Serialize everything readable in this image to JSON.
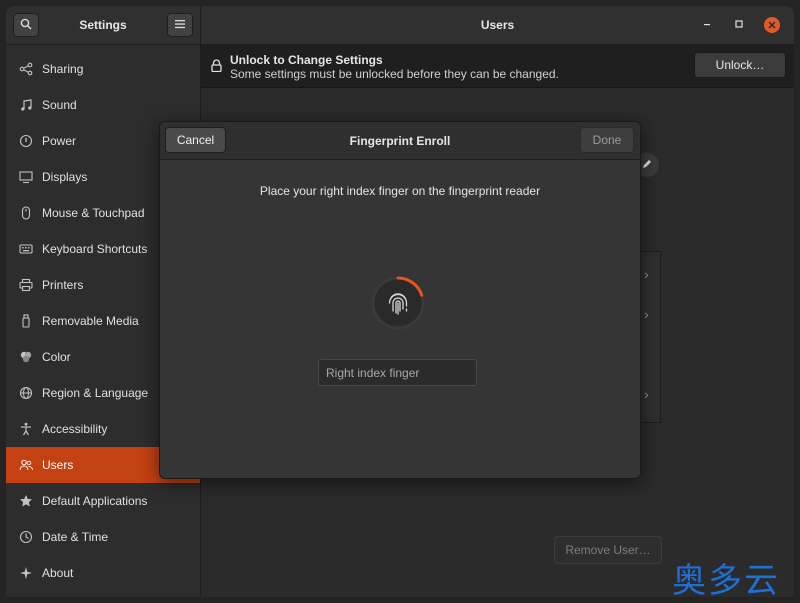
{
  "app": {
    "title": "Settings"
  },
  "window": {
    "title": "Users"
  },
  "sidebar": {
    "items": [
      {
        "label": "Sharing",
        "icon": "share-icon"
      },
      {
        "label": "Sound",
        "icon": "music-note-icon"
      },
      {
        "label": "Power",
        "icon": "power-icon"
      },
      {
        "label": "Displays",
        "icon": "display-icon"
      },
      {
        "label": "Mouse & Touchpad",
        "icon": "mouse-icon"
      },
      {
        "label": "Keyboard Shortcuts",
        "icon": "keyboard-icon"
      },
      {
        "label": "Printers",
        "icon": "printer-icon"
      },
      {
        "label": "Removable Media",
        "icon": "usb-icon"
      },
      {
        "label": "Color",
        "icon": "color-icon"
      },
      {
        "label": "Region & Language",
        "icon": "globe-icon"
      },
      {
        "label": "Accessibility",
        "icon": "accessibility-icon"
      },
      {
        "label": "Users",
        "icon": "users-icon",
        "active": true
      },
      {
        "label": "Default Applications",
        "icon": "star-icon"
      },
      {
        "label": "Date & Time",
        "icon": "clock-icon"
      },
      {
        "label": "About",
        "icon": "sparkle-icon"
      }
    ]
  },
  "infobar": {
    "title": "Unlock to Change Settings",
    "subtitle": "Some settings must be unlocked before they can be changed.",
    "unlock_label": "Unlock…"
  },
  "main": {
    "remove_user_label": "Remove User…"
  },
  "dialog": {
    "title": "Fingerprint Enroll",
    "cancel_label": "Cancel",
    "done_label": "Done",
    "instruction": "Place your right index finger on the fingerprint reader",
    "finger_value": "Right index finger",
    "progress": 0.2
  },
  "watermark": {
    "text": "奥多云"
  },
  "colors": {
    "accent": "#c34113",
    "close": "#e05a28",
    "progress": "#e95420",
    "watermark": "#1f6fd6"
  }
}
